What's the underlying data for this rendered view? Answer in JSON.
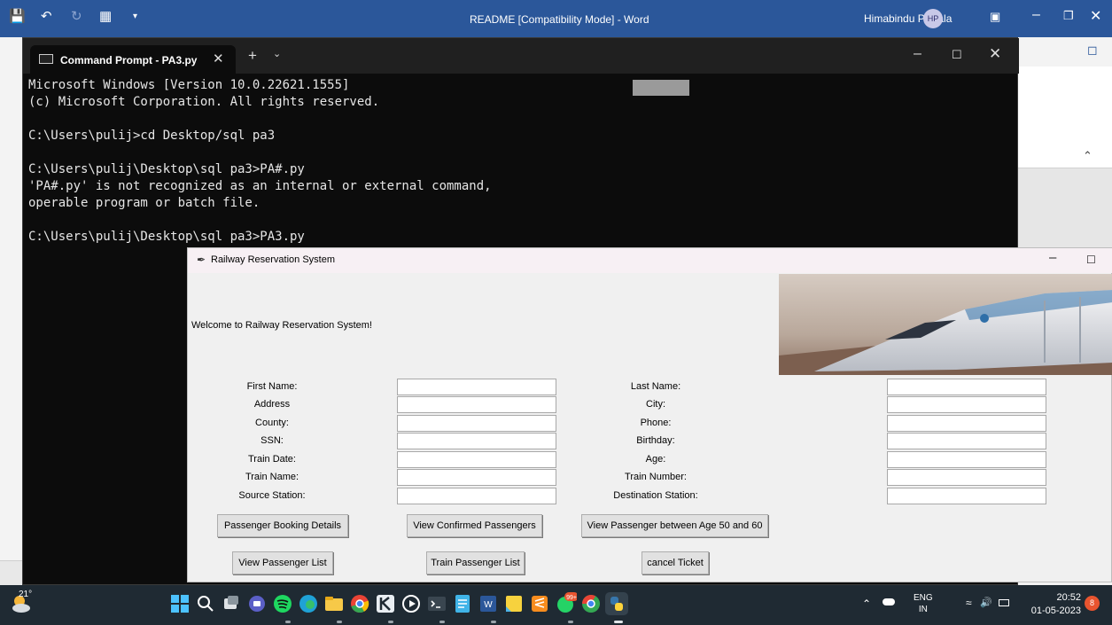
{
  "word": {
    "title": "README [Compatibility Mode]  -  Word",
    "user": "Himabindu Pulijala",
    "avatar_initials": "HP"
  },
  "cmd": {
    "tab_title": "Command Prompt - PA3.py",
    "lines": [
      "Microsoft Windows [Version 10.0.22621.1555]",
      "(c) Microsoft Corporation. All rights reserved.",
      "",
      "C:\\Users\\pulij>cd Desktop/sql pa3",
      "",
      "C:\\Users\\pulij\\Desktop\\sql pa3>PA#.py",
      "'PA#.py' is not recognized as an internal or external command,",
      "operable program or batch file.",
      "",
      "C:\\Users\\pulij\\Desktop\\sql pa3>PA3.py"
    ]
  },
  "app": {
    "title": "Railway Reservation System",
    "welcome": "Welcome to Railway Reservation System!",
    "fields_left": [
      {
        "label": "First Name:",
        "value": ""
      },
      {
        "label": "Address",
        "value": ""
      },
      {
        "label": "County:",
        "value": ""
      },
      {
        "label": "SSN:",
        "value": ""
      },
      {
        "label": "Train Date:",
        "value": ""
      },
      {
        "label": "Train Name:",
        "value": ""
      },
      {
        "label": "Source Station:",
        "value": ""
      }
    ],
    "fields_right": [
      {
        "label": "Last Name:",
        "value": ""
      },
      {
        "label": "City:",
        "value": ""
      },
      {
        "label": "Phone:",
        "value": ""
      },
      {
        "label": "Birthday:",
        "value": ""
      },
      {
        "label": "Age:",
        "value": ""
      },
      {
        "label": "Train Number:",
        "value": ""
      },
      {
        "label": "Destination Station:",
        "value": ""
      }
    ],
    "buttons": {
      "booking_details": "Passenger Booking Details",
      "confirmed": "View Confirmed Passengers",
      "age_range": "View Passenger between Age 50 and 60",
      "passenger_list": "View Passenger List",
      "train_list": "Train Passenger List",
      "cancel": "cancel Ticket"
    }
  },
  "taskbar": {
    "temperature": "21°",
    "apps": [
      "windows-start",
      "search",
      "task-view",
      "teams-chat",
      "spotify",
      "edge",
      "file-explorer",
      "chrome",
      "app-k",
      "media-player",
      "terminal",
      "notepad",
      "word",
      "sticky",
      "sublime",
      "whatsapp",
      "chrome-alt",
      "python"
    ],
    "whatsapp_badge": "99+",
    "lang_top": "ENG",
    "lang_bottom": "IN",
    "time": "20:52",
    "date": "01-05-2023",
    "notification_count": "8"
  }
}
